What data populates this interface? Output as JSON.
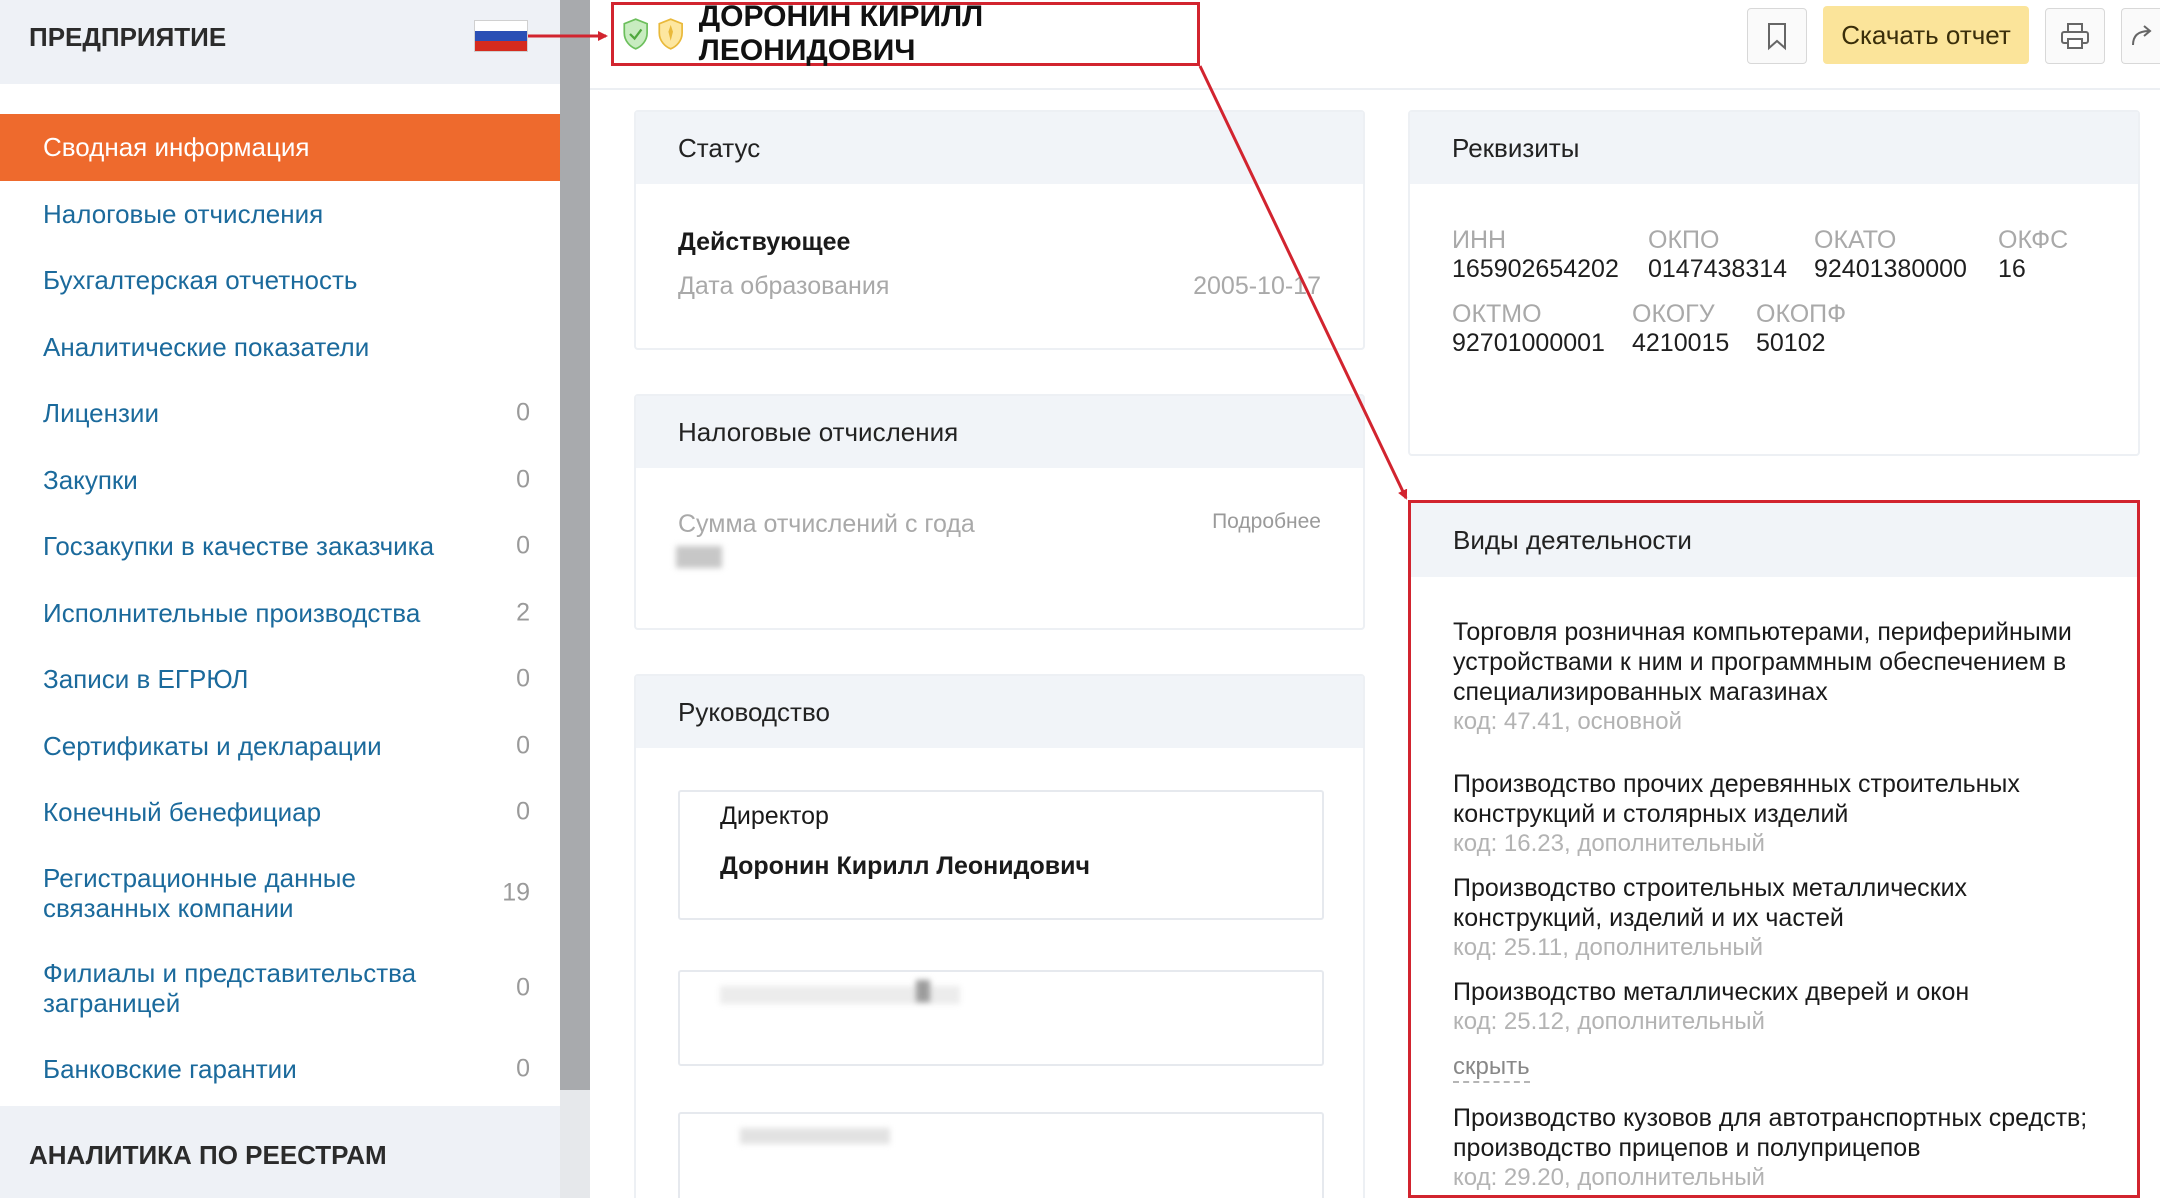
{
  "sidebar": {
    "title": "ПРЕДПРИЯТИЕ",
    "items": [
      {
        "label": "Сводная информация",
        "count": ""
      },
      {
        "label": "Налоговые отчисления",
        "count": ""
      },
      {
        "label": "Бухгалтерская отчетность",
        "count": ""
      },
      {
        "label": "Аналитические показатели",
        "count": ""
      },
      {
        "label": "Лицензии",
        "count": "0"
      },
      {
        "label": "Закупки",
        "count": "0"
      },
      {
        "label": "Госзакупки в качестве заказчика",
        "count": "0"
      },
      {
        "label": "Исполнительные производства",
        "count": "2"
      },
      {
        "label": "Записи в ЕГРЮЛ",
        "count": "0"
      },
      {
        "label": "Сертификаты и декларации",
        "count": "0"
      },
      {
        "label": "Конечный бенефициар",
        "count": "0"
      },
      {
        "label": "Регистрационные данные связанных компании",
        "count": "19"
      },
      {
        "label": "Филиалы и представительства заграницей",
        "count": "0"
      },
      {
        "label": "Банковские гарантии",
        "count": "0"
      }
    ],
    "footer_title": "АНАЛИТИКА ПО РЕЕСТРАМ"
  },
  "header": {
    "person_name": "ДОРОНИН КИРИЛЛ ЛЕОНИДОВИЧ",
    "download_label": "Скачать отчет"
  },
  "status_card": {
    "title": "Статус",
    "status": "Действующее",
    "date_label": "Дата образования",
    "date_value": "2005-10-17"
  },
  "tax_card": {
    "title": "Налоговые отчисления",
    "sum_label": "Сумма отчислений с года",
    "more_link": "Подробнее"
  },
  "management_card": {
    "title": "Руководство",
    "role": "Директор",
    "person": "Доронин Кирилл Леонидович"
  },
  "requisites_card": {
    "title": "Реквизиты",
    "row1": [
      {
        "label": "ИНН",
        "value": "165902654202"
      },
      {
        "label": "ОКПО",
        "value": "0147438314"
      },
      {
        "label": "ОКАТО",
        "value": "92401380000"
      },
      {
        "label": "ОКФС",
        "value": "16"
      }
    ],
    "row2": [
      {
        "label": "ОКТМО",
        "value": "92701000001"
      },
      {
        "label": "ОКОГУ",
        "value": "4210015"
      },
      {
        "label": "ОКОПФ",
        "value": "50102"
      }
    ]
  },
  "activities": {
    "title": "Виды деятельности",
    "items": [
      {
        "name": "Торговля розничная компьютерами, периферийными устройствами к ним и программным обеспечением в специализированных магазинах",
        "code": "код: 47.41, основной"
      },
      {
        "name": "Производство прочих деревянных строительных конструкций и столярных изделий",
        "code": "код: 16.23, дополнительный"
      },
      {
        "name": "Производство строительных металлических конструкций, изделий и их частей",
        "code": "код: 25.11, дополнительный"
      },
      {
        "name": "Производство металлических дверей и окон",
        "code": "код: 25.12, дополнительный"
      },
      {
        "name": "Производство кузовов для автотранспортных средств; производство прицепов и полуприцепов",
        "code": "код: 29.20, дополнительный"
      }
    ],
    "hide_label": "скрыть"
  },
  "colors": {
    "accent": "#ee6a2d",
    "link": "#1b6a9c",
    "highlight": "#d2242f",
    "download_bg": "#fbe49a"
  },
  "icons": {
    "bookmark": "bookmark-icon",
    "print": "printer-icon",
    "share": "share-icon",
    "shield_green": "shield-green-icon",
    "shield_yellow": "shield-yellow-icon",
    "flag": "russia-flag-icon"
  }
}
